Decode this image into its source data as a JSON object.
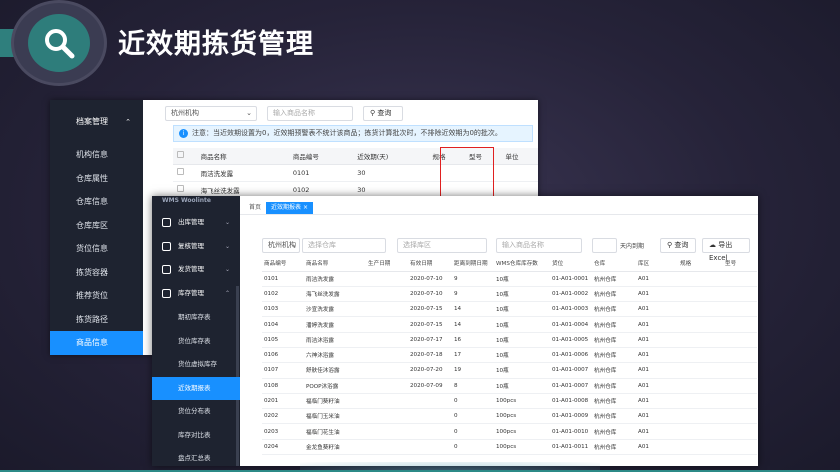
{
  "title": "近效期拣货管理",
  "back": {
    "side": {
      "group": "档案管理",
      "items": [
        "机构信息",
        "仓库属性",
        "仓库信息",
        "仓库库区",
        "货位信息",
        "拣货容器",
        "推荐货位",
        "拣货路径",
        "商品信息"
      ],
      "active_index": 8
    },
    "filters": {
      "org": "杭州机构",
      "name_placeholder": "输入商品名称",
      "query": "查询"
    },
    "notice": "注意：当近效期设置为0，近效期预警表不统计该商品；拣货计算批次时，不排除近效期为0的批次。",
    "columns": [
      "商品名称",
      "商品编号",
      "近效期(天)",
      "规格",
      "型号",
      "单位"
    ],
    "rows": [
      [
        "雨洁洗发露",
        "0101",
        "30",
        "",
        "",
        ""
      ],
      [
        "海飞丝洗发露",
        "0102",
        "30",
        "",
        "",
        ""
      ]
    ]
  },
  "front": {
    "logo": "WMS Woolinte",
    "side": {
      "groups": [
        {
          "label": "出库管理"
        },
        {
          "label": "复核管理"
        },
        {
          "label": "发货管理"
        },
        {
          "label": "库存管理"
        }
      ],
      "items": [
        "期初库存表",
        "货位库存表",
        "货位虚拟库存",
        "近效期报表",
        "货位分布表",
        "库存对比表",
        "盘点汇总表"
      ],
      "active_index": 3
    },
    "tabs": [
      "首页",
      "近效期报表"
    ],
    "filters": {
      "org": "杭州机构",
      "product_placeholder": "选择仓库",
      "area_placeholder": "选择库区",
      "name_placeholder": "输入商品名称",
      "days_suffix": "天内到期",
      "query": "查询",
      "export": "导出Excel"
    },
    "columns": [
      "商品编号",
      "商品名称",
      "生产日期",
      "有效日期",
      "距离到期日期",
      "WMS仓库库存数",
      "货位",
      "仓库",
      "库区",
      "规格",
      "型号"
    ],
    "rows": [
      [
        "0101",
        "雨洁洗发露",
        "",
        "2020-07-10",
        "9",
        "10瓶",
        "01-A01-0001",
        "杭州仓库",
        "A01",
        "",
        ""
      ],
      [
        "0102",
        "海飞丝洗发露",
        "",
        "2020-07-10",
        "9",
        "10瓶",
        "01-A01-0002",
        "杭州仓库",
        "A01",
        "",
        ""
      ],
      [
        "0103",
        "沙宣洗发露",
        "",
        "2020-07-15",
        "14",
        "10瓶",
        "01-A01-0003",
        "杭州仓库",
        "A01",
        "",
        ""
      ],
      [
        "0104",
        "潘婷洗发露",
        "",
        "2020-07-15",
        "14",
        "10瓶",
        "01-A01-0004",
        "杭州仓库",
        "A01",
        "",
        ""
      ],
      [
        "0105",
        "雨洁沐浴露",
        "",
        "2020-07-17",
        "16",
        "10瓶",
        "01-A01-0005",
        "杭州仓库",
        "A01",
        "",
        ""
      ],
      [
        "0106",
        "六神沐浴露",
        "",
        "2020-07-18",
        "17",
        "10瓶",
        "01-A01-0006",
        "杭州仓库",
        "A01",
        "",
        ""
      ],
      [
        "0107",
        "舒肤佳沐浴露",
        "",
        "2020-07-20",
        "19",
        "10瓶",
        "01-A01-0007",
        "杭州仓库",
        "A01",
        "",
        ""
      ],
      [
        "0108",
        "POOP沐浴露",
        "",
        "2020-07-09",
        "8",
        "10瓶",
        "01-A01-0007",
        "杭州仓库",
        "A01",
        "",
        ""
      ],
      [
        "0201",
        "福临门葵籽油",
        "",
        "",
        "0",
        "100pcs",
        "01-A01-0008",
        "杭州仓库",
        "A01",
        "",
        ""
      ],
      [
        "0202",
        "福临门玉米油",
        "",
        "",
        "0",
        "100pcs",
        "01-A01-0009",
        "杭州仓库",
        "A01",
        "",
        ""
      ],
      [
        "0203",
        "福临门花生油",
        "",
        "",
        "0",
        "100pcs",
        "01-A01-0010",
        "杭州仓库",
        "A01",
        "",
        ""
      ],
      [
        "0204",
        "金龙鱼葵籽油",
        "",
        "",
        "0",
        "100pcs",
        "01-A01-0011",
        "杭州仓库",
        "A01",
        "",
        ""
      ]
    ]
  },
  "colors": {
    "accent": "#1890ff",
    "teal": "#2e7d7b",
    "sidebar": "#1e2330",
    "highlight": "#e02020"
  }
}
